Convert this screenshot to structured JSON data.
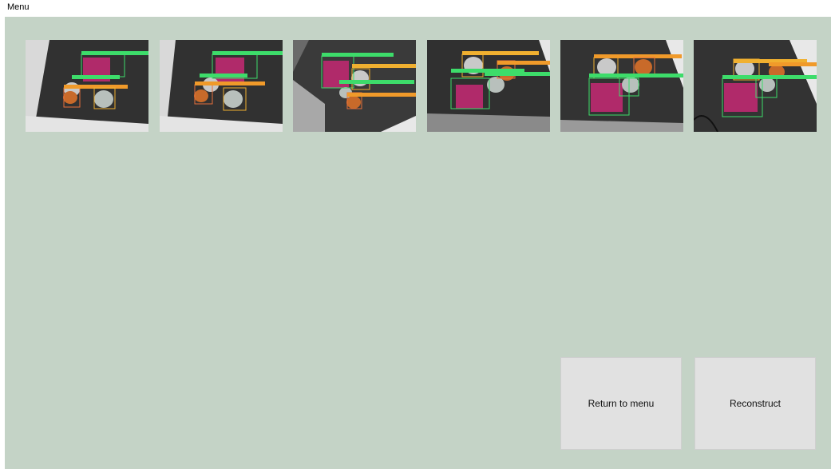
{
  "menubar": {
    "menu_label": "Menu"
  },
  "images": [
    {
      "name": "detection-image-1"
    },
    {
      "name": "detection-image-2"
    },
    {
      "name": "detection-image-3"
    },
    {
      "name": "detection-image-4"
    },
    {
      "name": "detection-image-5"
    },
    {
      "name": "detection-image-6"
    }
  ],
  "buttons": {
    "return_label": "Return to menu",
    "reconstruct_label": "Reconstruct"
  },
  "colors": {
    "background": "#c4d3c6",
    "button": "#e1e1e1",
    "box_green": "#3ddc6a",
    "box_orange": "#f09a2a",
    "box_red_orange": "#e8703a"
  }
}
